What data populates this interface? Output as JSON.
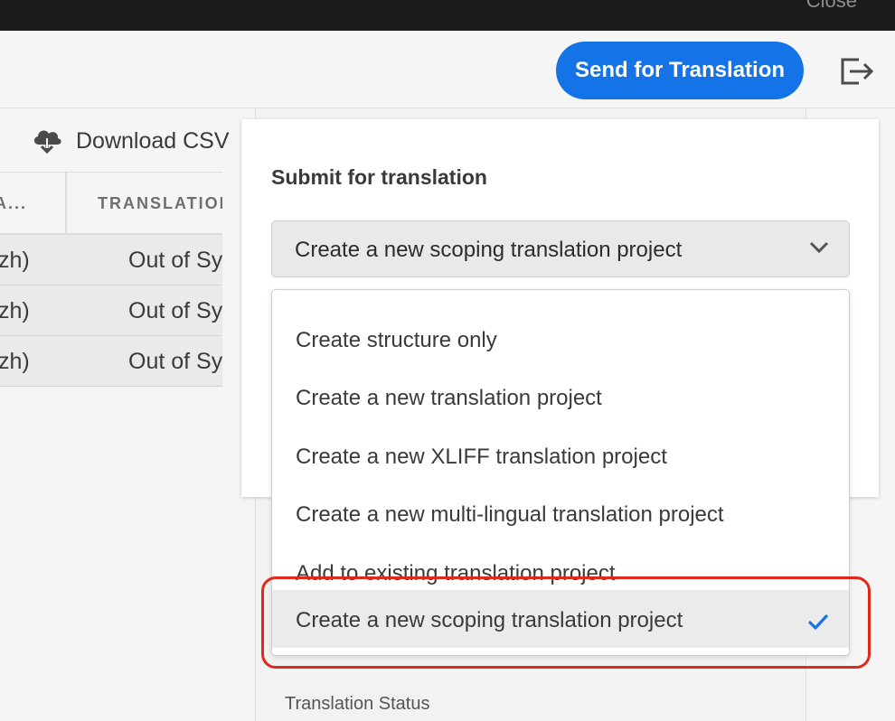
{
  "topbar": {
    "close_label": "Close"
  },
  "actionbar": {
    "send_button": "Send for Translation",
    "exit_icon": "exit-icon"
  },
  "toolbar": {
    "download_label": "Download CSV",
    "download_icon": "cloud-download-icon"
  },
  "table": {
    "headers": [
      "A...",
      "TRANSLATION"
    ],
    "rows": [
      [
        "zh)",
        "Out of Sync"
      ],
      [
        "zh)",
        "Out of Sync"
      ],
      [
        "zh)",
        "Out of Sync"
      ]
    ]
  },
  "popover": {
    "title": "Submit for translation",
    "selected_value": "Create a new scoping translation project",
    "options": [
      "Create structure only",
      "Create a new translation project",
      "Create a new XLIFF translation project",
      "Create a new multi-lingual translation project",
      "Add to existing translation project",
      "Create a new scoping translation project"
    ],
    "selected_index": 5
  },
  "sidepanel": {
    "status_label": "Translation Status"
  },
  "colors": {
    "accent": "#1473e6",
    "highlight": "#e0291b",
    "checkmark": "#1473e6"
  }
}
